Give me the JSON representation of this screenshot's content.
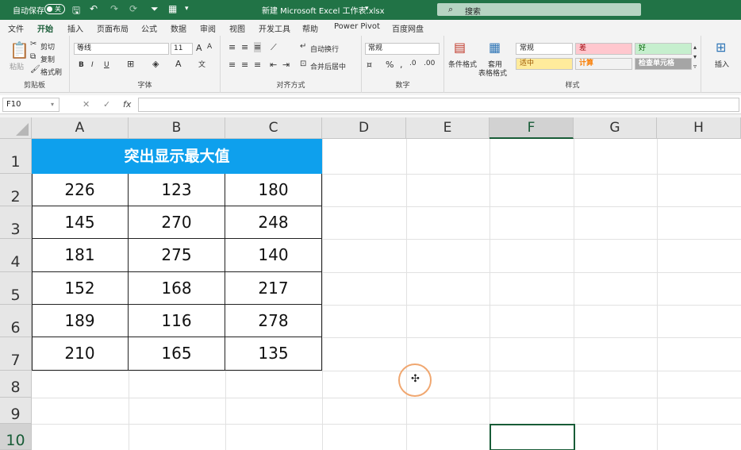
{
  "titlebar": {
    "autosave_label": "自动保存",
    "autosave_state": "关",
    "doc_title": "新建 Microsoft Excel 工作表.xlsx",
    "search_placeholder": "搜索"
  },
  "menu": [
    "文件",
    "开始",
    "插入",
    "页面布局",
    "公式",
    "数据",
    "审阅",
    "视图",
    "开发工具",
    "帮助",
    "Power Pivot",
    "百度网盘"
  ],
  "active_menu": "开始",
  "ribbon": {
    "clipboard": {
      "label": "剪贴板",
      "paste": "粘贴",
      "cut": "剪切",
      "copy": "复制",
      "format_painter": "格式刷"
    },
    "font": {
      "label": "字体",
      "name": "等线",
      "size": "11",
      "bold": "B",
      "italic": "I",
      "underline": "U"
    },
    "alignment": {
      "label": "对齐方式",
      "wrap": "自动换行",
      "merge": "合并后居中"
    },
    "number": {
      "label": "数字",
      "format": "常规"
    },
    "styles": {
      "label": "样式",
      "conditional": "条件格式",
      "table_format_1": "套用",
      "table_format_2": "表格格式",
      "cells": [
        {
          "text": "常规",
          "bg": "#ffffff",
          "color": "#222222"
        },
        {
          "text": "差",
          "bg": "#ffc7ce",
          "color": "#9c0006"
        },
        {
          "text": "好",
          "bg": "#c6efce",
          "color": "#006100"
        },
        {
          "text": "适中",
          "bg": "#ffeb9c",
          "color": "#9c5700"
        },
        {
          "text": "计算",
          "bg": "#f2f2f2",
          "color": "#fa7d00"
        },
        {
          "text": "检查单元格",
          "bg": "#a5a5a5",
          "color": "#ffffff"
        }
      ]
    },
    "cells_group": {
      "insert": "插入"
    }
  },
  "formula_bar": {
    "name_box": "F10",
    "cancel": "✕",
    "confirm": "✓",
    "fx": "fx",
    "content": ""
  },
  "grid": {
    "columns": [
      "A",
      "B",
      "C",
      "D",
      "E",
      "F",
      "G",
      "H"
    ],
    "rows": [
      "1",
      "2",
      "3",
      "4",
      "5",
      "6",
      "7",
      "8",
      "9",
      "10"
    ],
    "selected_column": "F",
    "selected_row": "10",
    "active_cell": "F10",
    "table_title": "突出显示最大值",
    "table_rows": [
      [
        "226",
        "123",
        "180"
      ],
      [
        "145",
        "270",
        "248"
      ],
      [
        "181",
        "275",
        "140"
      ],
      [
        "152",
        "168",
        "217"
      ],
      [
        "189",
        "116",
        "278"
      ],
      [
        "210",
        "165",
        "135"
      ]
    ]
  },
  "colors": {
    "accent": "#217346",
    "table_header": "#0ea0ed"
  }
}
